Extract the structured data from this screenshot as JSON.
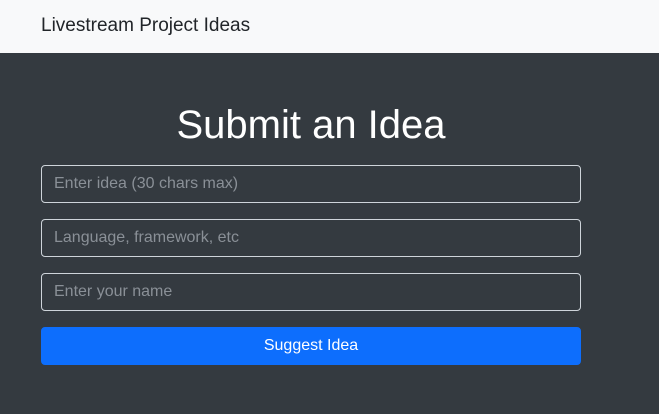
{
  "navbar": {
    "brand": "Livestream Project Ideas"
  },
  "form": {
    "title": "Submit an Idea",
    "idea_placeholder": "Enter idea (30 chars max)",
    "tech_placeholder": "Language, framework, etc",
    "name_placeholder": "Enter your name",
    "submit_label": "Suggest Idea"
  },
  "colors": {
    "navbar_bg": "#f8f9fa",
    "main_bg": "#343a40",
    "primary_button": "#0d6efd"
  }
}
